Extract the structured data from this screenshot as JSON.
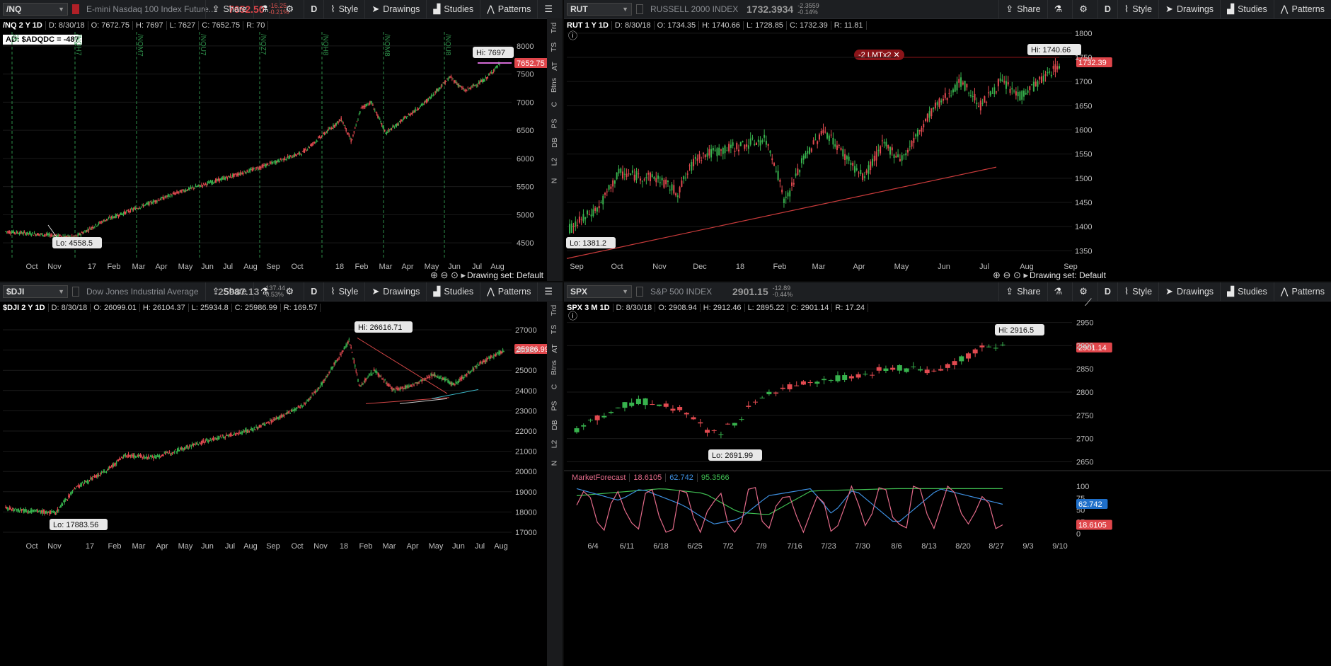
{
  "colors": {
    "up": "#37b24d",
    "down": "#e24a50",
    "accent": "#e0464b",
    "bg": "#000000"
  },
  "toolbar_buttons": {
    "share": "Share",
    "style": "Style",
    "drawings": "Drawings",
    "studies": "Studies",
    "patterns": "Patterns",
    "period": "D"
  },
  "drawing_set": "Drawing set: Default",
  "side_tabs": [
    "Trd",
    "TS",
    "AT",
    "Btns",
    "C",
    "PS",
    "DB",
    "L2",
    "N"
  ],
  "panes": [
    {
      "symbol": "/NQ",
      "description": "E-mini Nasdaq 100 Index Future...",
      "price": "7652.50",
      "change": "-16.25",
      "change_pct": "-0.21%",
      "info": {
        "title": "/NQ 2 Y 1D",
        "date": "D: 8/30/18",
        "open": "O: 7672.75",
        "high": "H: 7697",
        "low": "L: 7627",
        "close": "C: 7652.75",
        "range": "R: 70"
      },
      "study_label": "AD: $ADQDC = -487",
      "hi_label": "Hi: 7697",
      "lo_label": "Lo: 4558.5",
      "price_badge": "7652.75",
      "y_ticks": [
        "8000",
        "7500",
        "7000",
        "6500",
        "6000",
        "5500",
        "5000",
        "4500"
      ],
      "x_ticks": [
        "Oct",
        "Nov",
        "17",
        "Feb",
        "Mar",
        "Apr",
        "May",
        "Jun",
        "Jul",
        "Aug",
        "Sep",
        "Oct",
        "18",
        "Feb",
        "Mar",
        "Apr",
        "May",
        "Jun",
        "Jul",
        "Aug"
      ],
      "expiries": [
        "/NQH7",
        "/NQM7",
        "/NQU7",
        "/NQZ7",
        "/NQH8",
        "/NQM8",
        "/NQU8"
      ]
    },
    {
      "symbol": "RUT",
      "description": "RUSSELL 2000 INDEX",
      "price": "1732.3934",
      "change": "-2.3559",
      "change_pct": "-0.14%",
      "info": {
        "title": "RUT 1 Y 1D",
        "date": "D: 8/30/18",
        "open": "O: 1734.35",
        "high": "H: 1740.66",
        "low": "L: 1728.85",
        "close": "C: 1732.39",
        "range": "R: 11.81"
      },
      "hi_label": "Hi: 1740.66",
      "lo_label": "Lo: 1381.2",
      "price_badge": "1732.39",
      "order_label": "-2 LMTx2",
      "y_ticks": [
        "1800",
        "1750",
        "1700",
        "1650",
        "1600",
        "1550",
        "1500",
        "1450",
        "1400",
        "1350"
      ],
      "x_ticks": [
        "Sep",
        "Oct",
        "Nov",
        "Dec",
        "18",
        "Feb",
        "Mar",
        "Apr",
        "May",
        "Jun",
        "Jul",
        "Aug",
        "Sep"
      ]
    },
    {
      "symbol": "$DJI",
      "description": "Dow Jones Industrial Average",
      "price": "25987.13",
      "change": "-137.44",
      "change_pct": "-0.53%",
      "info": {
        "title": "$DJI 2 Y 1D",
        "date": "D: 8/30/18",
        "open": "O: 26099.01",
        "high": "H: 26104.37",
        "low": "L: 25934.8",
        "close": "C: 25986.99",
        "range": "R: 169.57"
      },
      "hi_label": "Hi: 26616.71",
      "lo_label": "Lo: 17883.56",
      "price_badge": "25986.99",
      "y_ticks": [
        "27000",
        "26000",
        "25000",
        "24000",
        "23000",
        "22000",
        "21000",
        "20000",
        "19000",
        "18000",
        "17000"
      ],
      "x_ticks": [
        "Oct",
        "Nov",
        "17",
        "Feb",
        "Mar",
        "Apr",
        "May",
        "Jun",
        "Jul",
        "Aug",
        "Sep",
        "Oct",
        "Nov",
        "18",
        "Feb",
        "Mar",
        "Apr",
        "May",
        "Jun",
        "Jul",
        "Aug"
      ]
    },
    {
      "symbol": "SPX",
      "description": "S&P 500 INDEX",
      "price": "2901.15",
      "change": "-12.89",
      "change_pct": "-0.44%",
      "info": {
        "title": "SPX 3 M 1D",
        "date": "D: 8/30/18",
        "open": "O: 2908.94",
        "high": "H: 2912.46",
        "low": "L: 2895.22",
        "close": "C: 2901.14",
        "range": "R: 17.24"
      },
      "hi_label": "Hi: 2916.5",
      "lo_label": "Lo: 2691.99",
      "price_badge": "2901.14",
      "y_ticks": [
        "2950",
        "2900",
        "2850",
        "2800",
        "2750",
        "2700",
        "2650"
      ],
      "x_ticks": [
        "6/4",
        "6/11",
        "6/18",
        "6/25",
        "7/2",
        "7/9",
        "7/16",
        "7/23",
        "7/30",
        "8/6",
        "8/13",
        "8/20",
        "8/27",
        "9/3",
        "9/10"
      ],
      "study": {
        "name": "MarketForecast",
        "v1": "18.6105",
        "v2": "62.742",
        "v3": "95.3566",
        "ticks": [
          "100",
          "75",
          "50",
          "25",
          "0"
        ],
        "badge_blue": "62.742",
        "badge_pink": "18.6105"
      }
    }
  ]
}
